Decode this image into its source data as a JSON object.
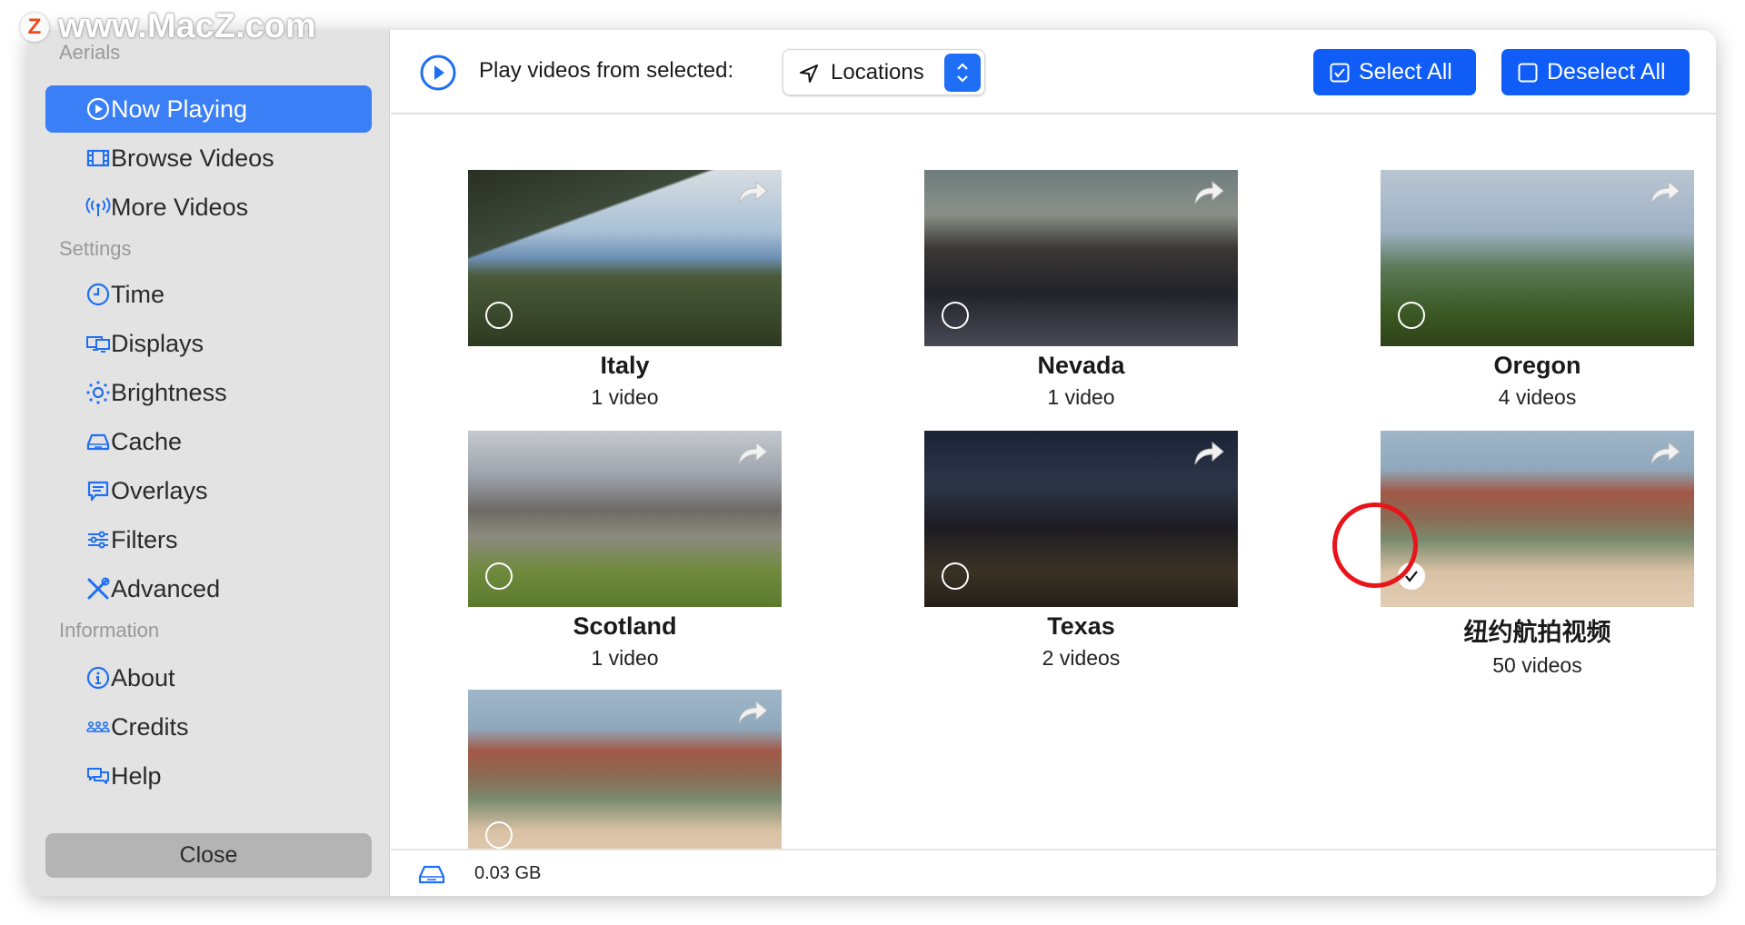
{
  "watermark": {
    "logo": "Z",
    "text": "www.MacZ.com"
  },
  "sidebar": {
    "sections": [
      "Aerials",
      "Settings",
      "Information"
    ],
    "items": [
      {
        "label": "Now Playing",
        "icon": "play-circle-icon",
        "active": true
      },
      {
        "label": "Browse Videos",
        "icon": "film-icon"
      },
      {
        "label": "More Videos",
        "icon": "antenna-icon"
      },
      {
        "label": "Time",
        "icon": "clock-icon"
      },
      {
        "label": "Displays",
        "icon": "displays-icon"
      },
      {
        "label": "Brightness",
        "icon": "sun-icon"
      },
      {
        "label": "Cache",
        "icon": "drive-icon"
      },
      {
        "label": "Overlays",
        "icon": "speech-bubble-icon"
      },
      {
        "label": "Filters",
        "icon": "sliders-icon"
      },
      {
        "label": "Advanced",
        "icon": "tools-icon"
      },
      {
        "label": "About",
        "icon": "info-icon"
      },
      {
        "label": "Credits",
        "icon": "people-icon"
      },
      {
        "label": "Help",
        "icon": "chat-bubbles-icon"
      }
    ],
    "close_label": "Close"
  },
  "header": {
    "play_label": "Play videos from selected:",
    "popup_value": "Locations",
    "select_all": "Select All",
    "deselect_all": "Deselect All"
  },
  "cards": [
    {
      "title": "Italy",
      "count": "1 video",
      "selected": false
    },
    {
      "title": "Nevada",
      "count": "1 video",
      "selected": false
    },
    {
      "title": "Oregon",
      "count": "4 videos",
      "selected": false
    },
    {
      "title": "Scotland",
      "count": "1 video",
      "selected": false
    },
    {
      "title": "Texas",
      "count": "2 videos",
      "selected": false
    },
    {
      "title": "纽约航拍视频",
      "count": "50 videos",
      "selected": true
    },
    {
      "selected": false
    }
  ],
  "footer": {
    "cache_size": "0.03 GB"
  },
  "colors": {
    "accent": "#0f5cf7",
    "sidebar_active": "#3a7ff6",
    "annotation": "#e8141a"
  }
}
